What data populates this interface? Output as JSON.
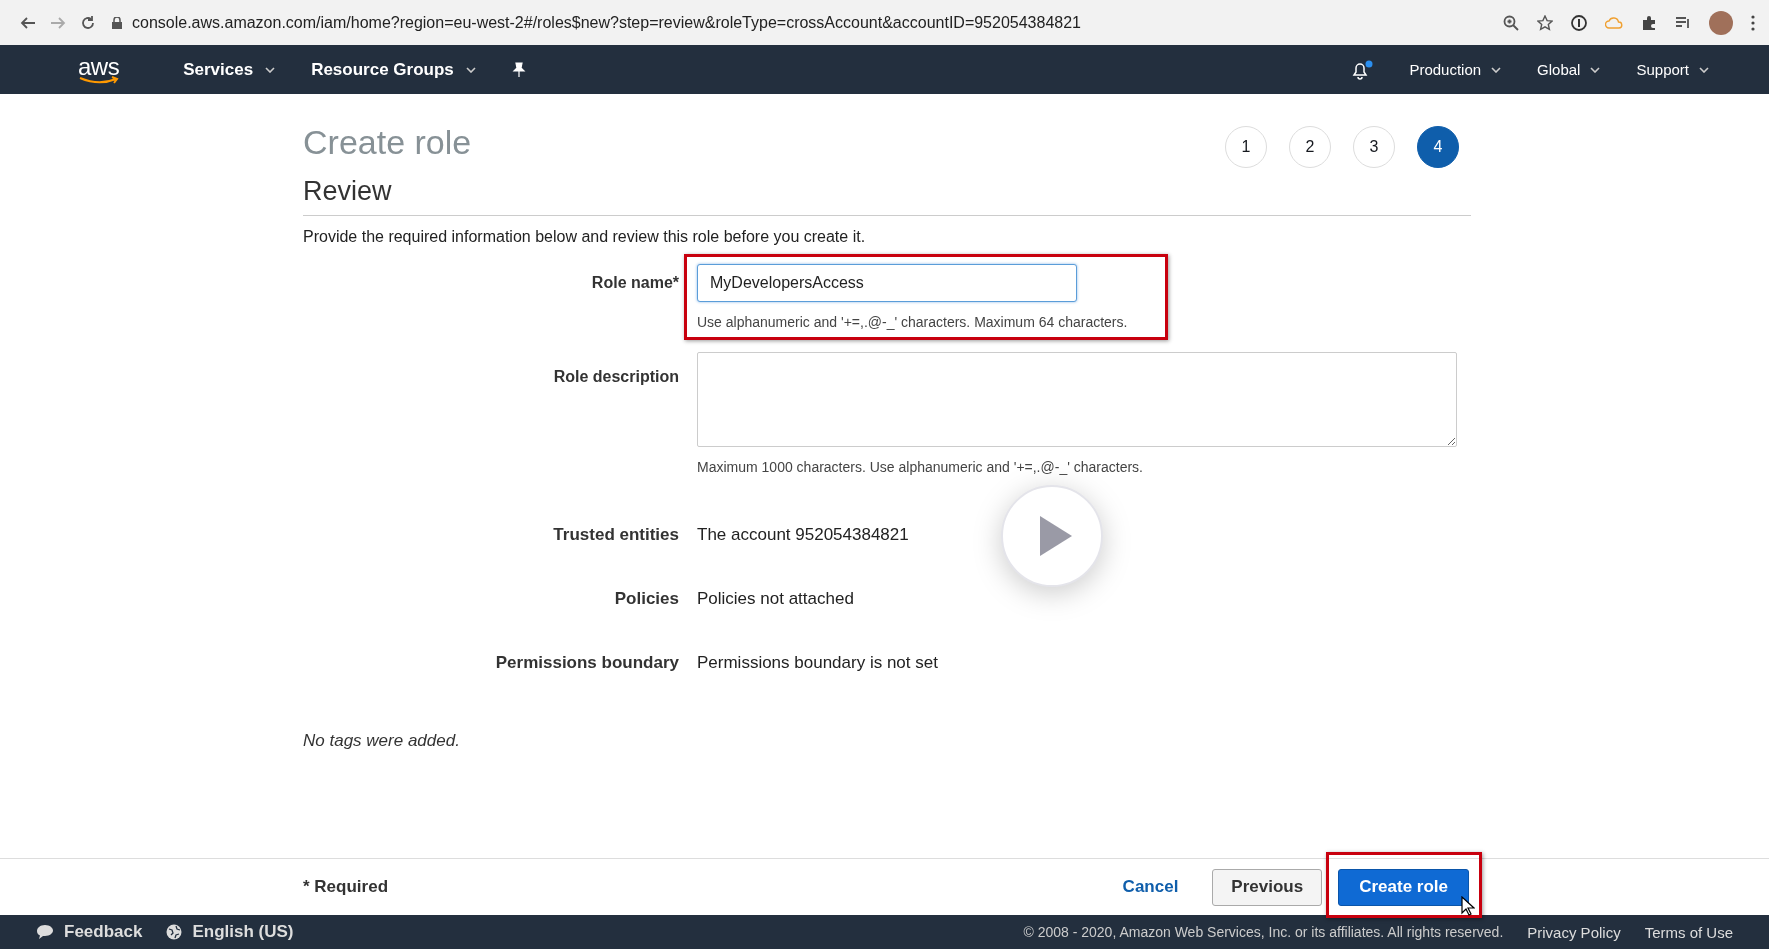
{
  "browser": {
    "url": "console.aws.amazon.com/iam/home?region=eu-west-2#/roles$new?step=review&roleType=crossAccount&accountID=952054384821"
  },
  "nav": {
    "logo": "aws",
    "menus": [
      {
        "label": "Services"
      },
      {
        "label": "Resource Groups"
      }
    ],
    "right_menus": [
      {
        "label": "Production"
      },
      {
        "label": "Global"
      },
      {
        "label": "Support"
      }
    ]
  },
  "page": {
    "title": "Create role",
    "steps": [
      {
        "label": "1",
        "selected": false
      },
      {
        "label": "2",
        "selected": false
      },
      {
        "label": "3",
        "selected": false
      },
      {
        "label": "4",
        "selected": true
      }
    ],
    "section": "Review",
    "intro": "Provide the required information below and review this role before you create it.",
    "fields": [
      {
        "kind": "input",
        "label": "Role name*",
        "value": "MyDevelopersAccess",
        "hint": "Use alphanumeric and '+=,.@-_' characters. Maximum 64 characters."
      },
      {
        "kind": "textarea",
        "label": "Role description",
        "hint": "Maximum 1000 characters. Use alphanumeric and '+=,.@-_' characters."
      },
      {
        "kind": "text",
        "label": "Trusted entities",
        "value": "The account 952054384821"
      },
      {
        "kind": "text",
        "label": "Policies",
        "value": "Policies not attached"
      },
      {
        "kind": "text",
        "label": "Permissions boundary",
        "value": "Permissions boundary is not set"
      }
    ],
    "note": "No tags were added."
  },
  "footer": {
    "required": "* Required",
    "cancel": "Cancel",
    "previous": "Previous",
    "create": "Create role"
  },
  "bottom": {
    "feedback": "Feedback",
    "language": "English (US)",
    "copyright": "© 2008 - 2020, Amazon Web Services, Inc. or its affiliates. All rights reserved.",
    "links": [
      "Privacy Policy",
      "Terms of Use"
    ]
  }
}
